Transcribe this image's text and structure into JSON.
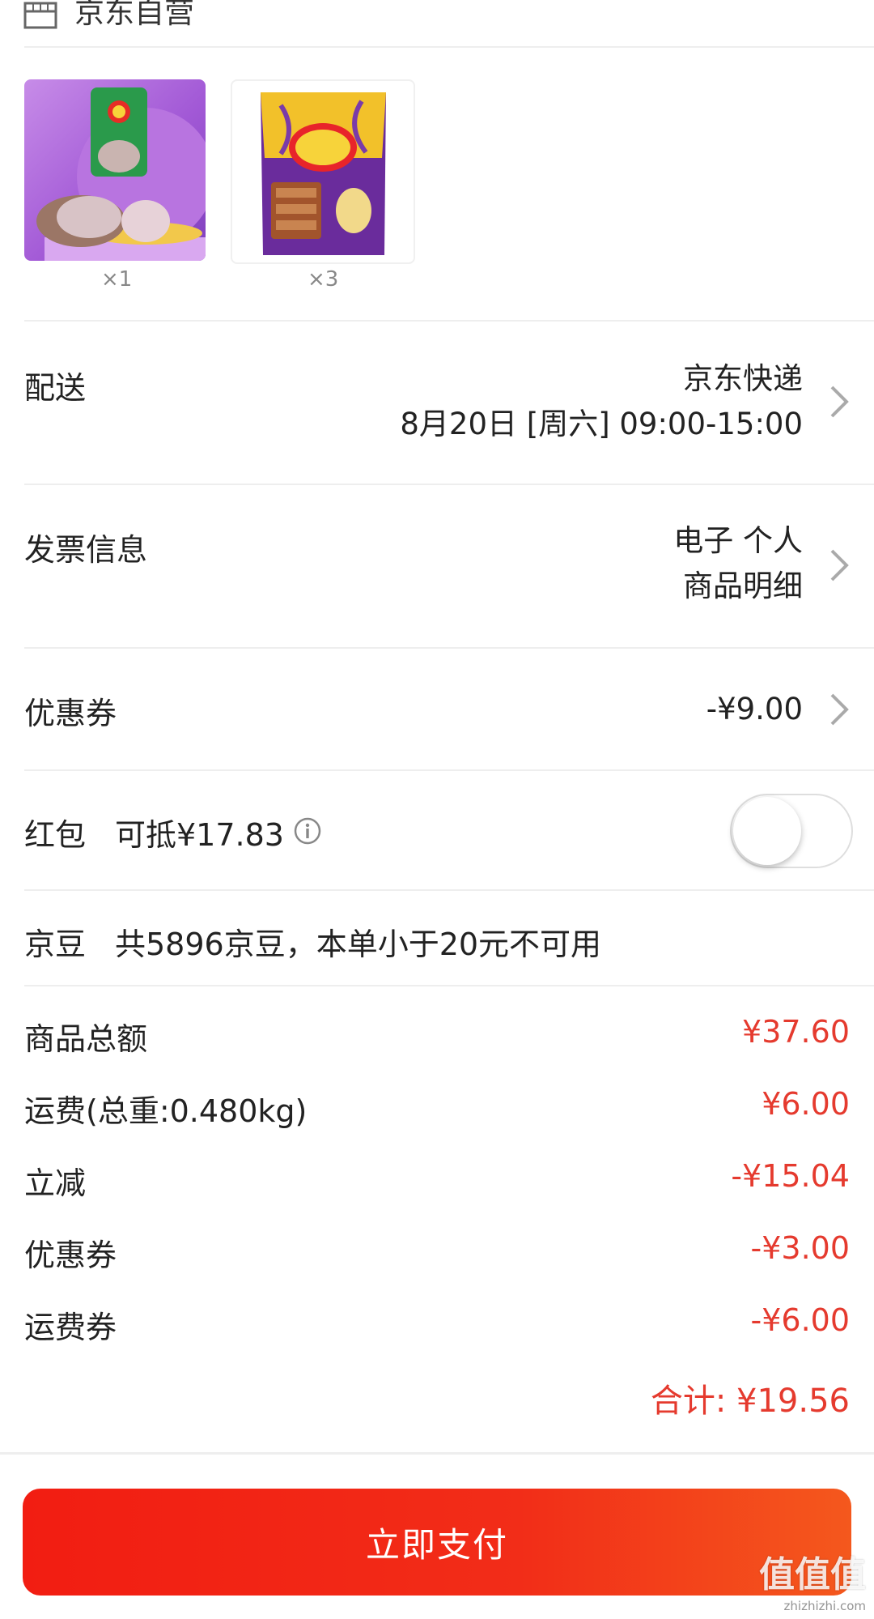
{
  "store": {
    "icon": "store-icon",
    "name": "京东自营"
  },
  "products": [
    {
      "image": "lays-taro-chips-image",
      "qty": "×1"
    },
    {
      "image": "lays-purple-chips-image",
      "qty": "×3"
    }
  ],
  "delivery": {
    "label": "配送",
    "carrier": "京东快递",
    "time": "8月20日 [周六] 09:00-15:00"
  },
  "invoice": {
    "label": "发票信息",
    "line1": "电子 个人",
    "line2": "商品明细"
  },
  "coupon": {
    "label": "优惠券",
    "value": "-¥9.00"
  },
  "red_packet": {
    "label": "红包",
    "deductible": "可抵¥17.83",
    "info_icon": "info-icon",
    "enabled": false
  },
  "jingdou": {
    "label": "京豆",
    "note": "共5896京豆，本单小于20元不可用"
  },
  "summary": [
    {
      "label": "商品总额",
      "value": "¥37.60"
    },
    {
      "label": "运费(总重:0.480kg)",
      "value": "¥6.00"
    },
    {
      "label": "立减",
      "value": "-¥15.04"
    },
    {
      "label": "优惠券",
      "value": "-¥3.00"
    },
    {
      "label": "运费券",
      "value": "-¥6.00"
    }
  ],
  "total": {
    "text": "合计: ¥19.56"
  },
  "pay_button": {
    "label": "立即支付"
  },
  "watermark": {
    "line1": "值值值",
    "line2": "zhizhizhi.com"
  },
  "colors": {
    "accent": "#e53a2e",
    "button": "#f21d12",
    "divider": "#eeeeee"
  }
}
